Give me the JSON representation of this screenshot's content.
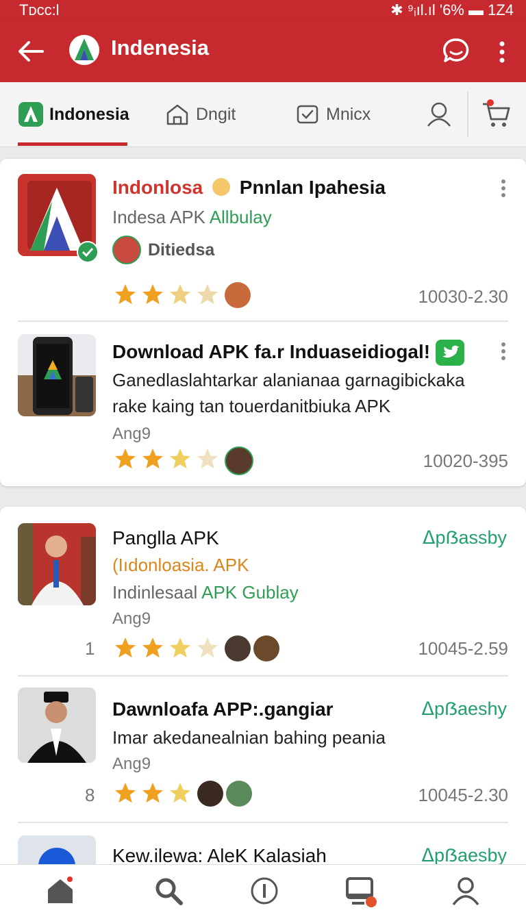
{
  "status": {
    "left": "Tᴅcc:l",
    "right": "✱ ⁹ᵢıl.ıl '6% ▬ 1Z4"
  },
  "appbar": {
    "title": "Indenesia"
  },
  "tabs": [
    {
      "label": "Indonesia"
    },
    {
      "label": "Dngit"
    },
    {
      "label": "Mnicx"
    }
  ],
  "card1": {
    "items": [
      {
        "title_red": "Indonlosa",
        "title_rest": "Pnnlan Ipahesia",
        "subtitle_gray": "Indesa APK",
        "subtitle_green": "Allbulay",
        "author": "Ditiedsa",
        "number": "10030-2.30",
        "rating": 4
      },
      {
        "title": "Download APK fa.r Induaseidiogal!",
        "desc1": "Ganedlaslahtarkar alanianaa garnagibickaka",
        "desc2": "rake kaing tan touerdanitbiuka APK",
        "meta": "Ang9",
        "number": "10020-395",
        "rating": 4
      }
    ]
  },
  "card2": {
    "items": [
      {
        "title": "Panglla APK",
        "subtitle_orange": "(Iıdonloasia. APK",
        "line3_gray": "Indinlesaal",
        "line3_green": "APK Gublay",
        "meta": "Ang9",
        "lead": "1",
        "brand": "ᐃpẞassby",
        "number": "10045-2.59",
        "rating": 4
      },
      {
        "title": "Dawnloafa APP:.gangiar",
        "desc": "Imar akedanealnian bahing peania",
        "meta": "Ang9",
        "lead": "8",
        "brand": "ᐃpẞaeshy",
        "number": "10045-2.30",
        "rating": 3
      },
      {
        "title": "Kew.ilewa: AleK Kalasiah",
        "brand": "ᐃpẞaesby"
      }
    ]
  },
  "colors": {
    "primary": "#c62a2f",
    "green": "#22a06b",
    "star": "#f0a020"
  }
}
